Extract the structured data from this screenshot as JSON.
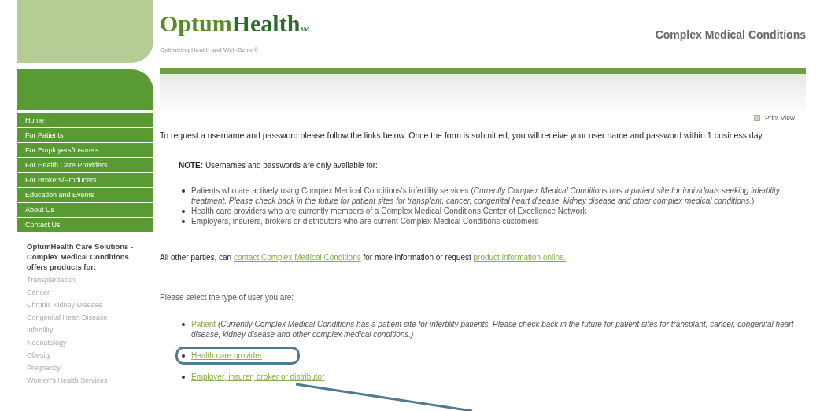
{
  "header": {
    "logo_part1": "Optum",
    "logo_part2": "Health",
    "logo_mark": "SM",
    "tagline": "Optimizing Health and Well-Being®",
    "site_title": "Complex Medical Conditions"
  },
  "nav": [
    {
      "label": "Home"
    },
    {
      "label": "For Patients"
    },
    {
      "label": "For Employers/Insurers"
    },
    {
      "label": "For Health Care Providers"
    },
    {
      "label": "For Brokers/Producers"
    },
    {
      "label": "Education and Events"
    },
    {
      "label": "About Us"
    },
    {
      "label": "Contact Us"
    }
  ],
  "sidebar": {
    "heading": "OptumHealth Care Solutions - Complex Medical Conditions offers products for:",
    "products": [
      "Transplantation",
      "Cancer",
      "Chronic Kidney Disease",
      "Congenital Heart Disease",
      "Infertility",
      "Neonatology",
      "Obesity",
      "Pregnancy",
      "Women's Health Services"
    ]
  },
  "print_view": "Print View",
  "intro": "To request a username and password please follow the links below. Once the form is submitted, you will receive your user name and password within 1 business day.",
  "note": "**NOTE:** Usernames and passwords are only available for:",
  "eligible": [
    "Patients who are actively using Complex Medical Conditions's infertility services (*Currently Complex Medical Conditions has a patient site for individuals seeking infertility treatment. Please check back in the future for patient sites for transplant, cancer, congenital heart disease, kidney disease and other complex medical conditions.*)",
    "Health care providers who are currently members of a Complex Medical Conditions Center of Excellence Network",
    "Employers, insurers, brokers or distributors who are current Complex Medical Conditions customers"
  ],
  "others": {
    "text_before": "All other parties, can",
    "link1": "contact Complex Medical Conditions",
    "text_middle": "for more information or request",
    "link2": "product information online."
  },
  "select_prompt": "Please select the type of user you are:",
  "user_types": [
    {
      "link": "Patient",
      "note": "(Currently Complex Medical Conditions has a patient site for infertility patients. Please check back in the future for patient sites for transplant, cancer, congenital heart disease, kidney disease and other complex medical conditions.)",
      "highlighted": false
    },
    {
      "link": "Health care provider",
      "highlighted": true
    },
    {
      "link": "Employer, insurer, broker or distributor",
      "highlighted": false
    }
  ]
}
